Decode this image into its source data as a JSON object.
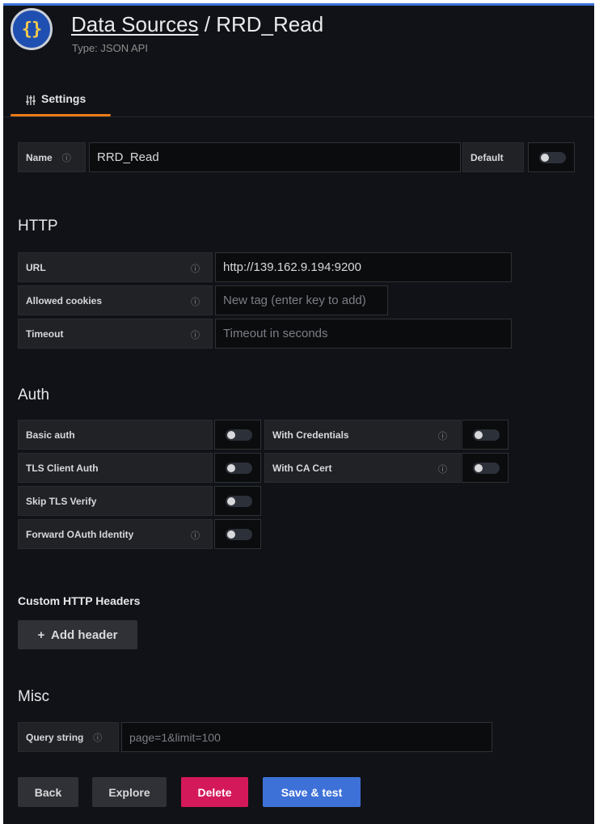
{
  "header": {
    "logo_glyph": "{}",
    "title_link": "Data Sources",
    "title_sep": " / ",
    "title_name": "RRD_Read",
    "type_text": "Type: JSON API"
  },
  "tabs": [
    {
      "label": "Settings",
      "icon": "sliders-icon",
      "active": true
    }
  ],
  "name_row": {
    "label": "Name",
    "value": "RRD_Read",
    "default_label": "Default",
    "default_on": false
  },
  "http": {
    "title": "HTTP",
    "url_label": "URL",
    "url_value": "http://139.162.9.194:9200",
    "cookies_label": "Allowed cookies",
    "cookies_placeholder": "New tag (enter key to add)",
    "timeout_label": "Timeout",
    "timeout_placeholder": "Timeout in seconds"
  },
  "auth": {
    "title": "Auth",
    "basic_auth": "Basic auth",
    "with_credentials": "With Credentials",
    "tls_client_auth": "TLS Client Auth",
    "with_ca_cert": "With CA Cert",
    "skip_tls_verify": "Skip TLS Verify",
    "forward_oauth": "Forward OAuth Identity"
  },
  "headers": {
    "title": "Custom HTTP Headers",
    "add_label": "+  Add header"
  },
  "misc": {
    "title": "Misc",
    "query_label": "Query string",
    "query_placeholder": "page=1&limit=100"
  },
  "actions": {
    "back": "Back",
    "explore": "Explore",
    "delete": "Delete",
    "save": "Save & test"
  },
  "colors": {
    "background": "#111217",
    "accent_tab": "#eb7b18",
    "primary": "#3e71d8",
    "destructive": "#d4195a"
  }
}
